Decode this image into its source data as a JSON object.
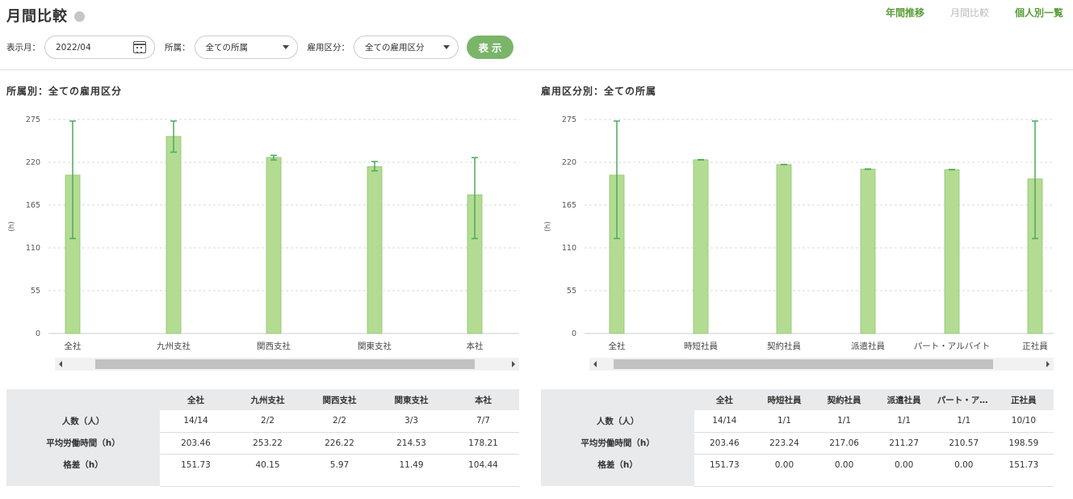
{
  "header": {
    "title": "月間比較",
    "nav": [
      {
        "label": "年間推移",
        "active": false
      },
      {
        "label": "月間比較",
        "active": true
      },
      {
        "label": "個人別一覧",
        "active": false
      }
    ]
  },
  "filters": {
    "month_label": "表示月：",
    "month_value": "2022/04",
    "dept_label": "所属：",
    "dept_value": "全ての所属",
    "employment_label": "雇用区分：",
    "employment_value": "全ての雇用区分",
    "show_button": "表示"
  },
  "colors": {
    "bar": "#b3dc92",
    "bar_stroke": "#8cc66a",
    "error_bar": "#4caa5c",
    "accent": "#5a9e3a",
    "button": "#7ab56a"
  },
  "left": {
    "title": "所属別：全ての雇用区分",
    "chart_data": {
      "type": "bar",
      "categories": [
        "全社",
        "九州支社",
        "関西支社",
        "関東支社",
        "本社"
      ],
      "values": [
        203.46,
        253.22,
        226.22,
        214.53,
        178.21
      ],
      "error_low": [
        122,
        233,
        223,
        209,
        122
      ],
      "error_high": [
        273,
        273,
        229,
        221,
        226
      ],
      "ylabel": "(h)",
      "ylim": [
        0,
        275
      ],
      "yticks": [
        0,
        55,
        110,
        165,
        220,
        275
      ],
      "grid": true
    },
    "table": {
      "columns": [
        "全社",
        "九州支社",
        "関西支社",
        "関東支社",
        "本社"
      ],
      "rows": [
        {
          "label": "人数（人）",
          "values": [
            "14/14",
            "2/2",
            "2/2",
            "3/3",
            "7/7"
          ]
        },
        {
          "label": "平均労働時間（h）",
          "values": [
            "203.46",
            "253.22",
            "226.22",
            "214.53",
            "178.21"
          ]
        },
        {
          "label": "格差（h）",
          "values": [
            "151.73",
            "40.15",
            "5.97",
            "11.49",
            "104.44"
          ]
        }
      ]
    }
  },
  "right": {
    "title": "雇用区分別：全ての所属",
    "chart_data": {
      "type": "bar",
      "categories": [
        "全社",
        "時短社員",
        "契約社員",
        "派遣社員",
        "パート・アルバイト",
        "正社員"
      ],
      "values": [
        203.46,
        223.24,
        217.06,
        211.27,
        210.57,
        198.59
      ],
      "error_low": [
        122,
        223,
        217,
        211,
        210.5,
        122
      ],
      "error_high": [
        273,
        223.5,
        217.3,
        211.5,
        210.8,
        273
      ],
      "ylabel": "(h)",
      "ylim": [
        0,
        275
      ],
      "yticks": [
        0,
        55,
        110,
        165,
        220,
        275
      ],
      "grid": true
    },
    "table": {
      "columns": [
        "全社",
        "時短社員",
        "契約社員",
        "派遣社員",
        "パート・アルバ…",
        "正社員"
      ],
      "rows": [
        {
          "label": "人数（人）",
          "values": [
            "14/14",
            "1/1",
            "1/1",
            "1/1",
            "1/1",
            "10/10"
          ]
        },
        {
          "label": "平均労働時間（h）",
          "values": [
            "203.46",
            "223.24",
            "217.06",
            "211.27",
            "210.57",
            "198.59"
          ]
        },
        {
          "label": "格差（h）",
          "values": [
            "151.73",
            "0.00",
            "0.00",
            "0.00",
            "0.00",
            "151.73"
          ]
        }
      ]
    }
  }
}
